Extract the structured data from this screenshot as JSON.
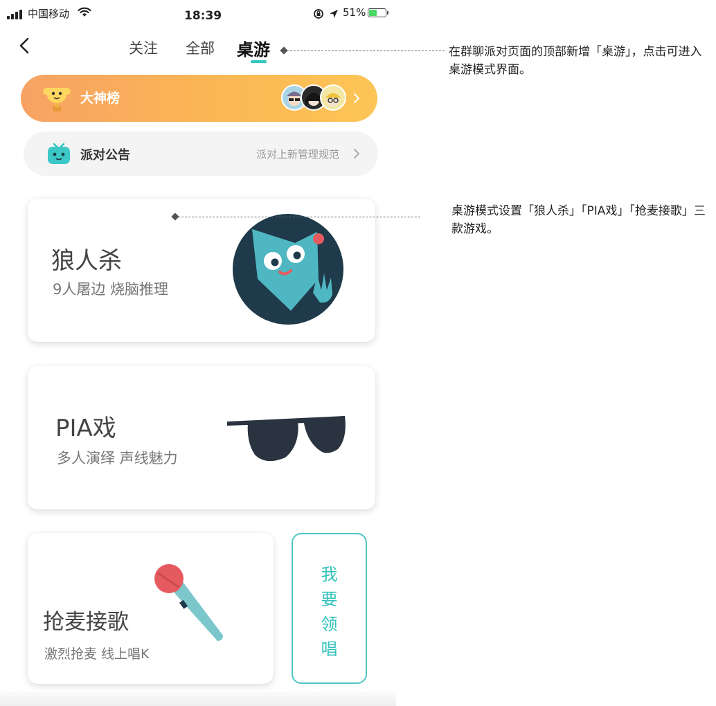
{
  "status_bar": {
    "carrier": "中国移动",
    "time": "18:39",
    "battery_pct": "51%",
    "battery_level": 0.51,
    "battery_color": "#4cd964"
  },
  "nav": {
    "back_icon": "chevron-left-icon",
    "tabs": [
      {
        "label": "关注",
        "active": false
      },
      {
        "label": "全部",
        "active": false
      },
      {
        "label": "桌游",
        "active": true
      }
    ],
    "accent": "#35c7c1"
  },
  "rank_banner": {
    "label": "大神榜",
    "icon": "trophy-icon",
    "avatars_count": 3,
    "gradient": [
      "#f7a264",
      "#fcc556"
    ]
  },
  "notice_banner": {
    "label": "派对公告",
    "subtitle": "派对上新管理规范",
    "icon": "tv-mascot-icon"
  },
  "games": [
    {
      "title": "狼人杀",
      "subtitle": "9人屠边 烧脑推理",
      "art": "wolf-illustration"
    },
    {
      "title": "PIA戏",
      "subtitle": "多人演绎 声线魅力",
      "art": "sunglasses-illustration"
    },
    {
      "title": "抢麦接歌",
      "subtitle": "激烈抢麦 线上唱K",
      "art": "microphone-illustration"
    }
  ],
  "lead_button": {
    "label": "我要领唱",
    "color": "#35c2bd"
  },
  "annotations": [
    "在群聊派对页面的顶部新增「桌游」，点击可进入桌游模式界面。",
    "桌游模式设置「狼人杀」「PIA戏」「抢麦接歌」三款游戏。"
  ]
}
